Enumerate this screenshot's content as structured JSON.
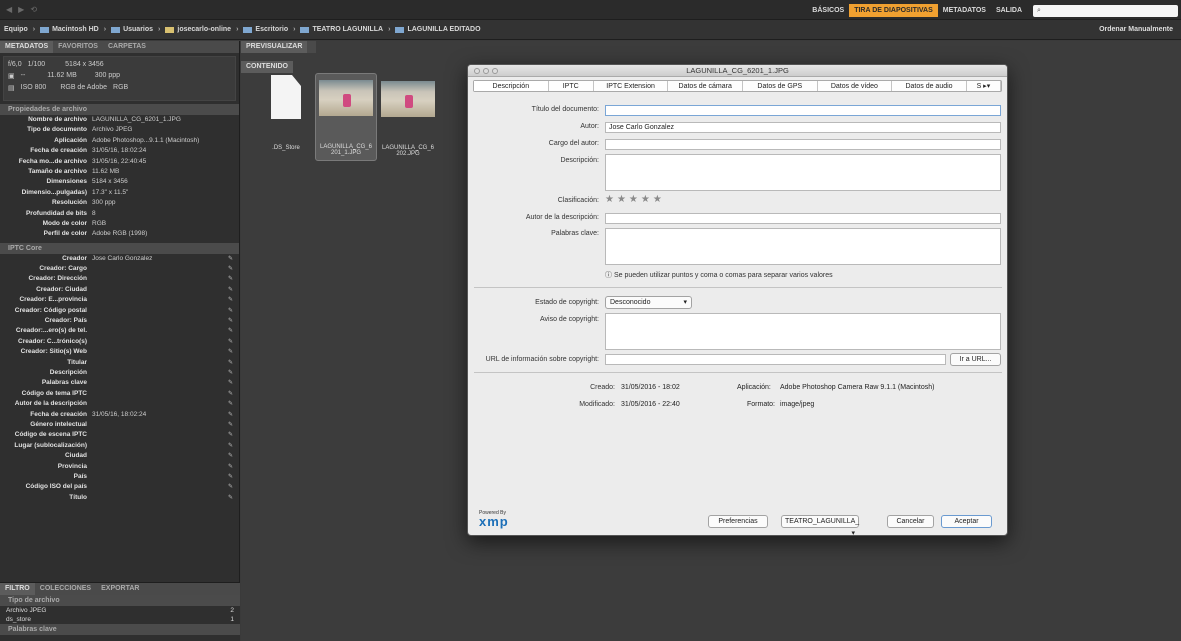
{
  "workspaces": [
    "BÁSICOS",
    "TIRA DE DIAPOSITIVAS",
    "METADATOS",
    "SALIDA"
  ],
  "active_workspace": "TIRA DE DIAPOSITIVAS",
  "path": [
    "Equipo",
    "Macintosh HD",
    "Usuarios",
    "josecarlo-online",
    "Escritorio",
    "TEATRO LAGUNILLA",
    "LAGUNILLA EDITADO"
  ],
  "sort_label": "Ordenar Manualmente",
  "left_tabs": [
    "METADATOS",
    "FAVORITOS",
    "CARPETAS"
  ],
  "camera": {
    "aperture": "f/6,0",
    "shutter": "1/100",
    "dims": "5184 x 3456",
    "size": "11.62 MB",
    "ppp": "300 ppp",
    "iso": "ISO 800",
    "profile": "RGB de Adobe",
    "mode": "RGB",
    "dash": "--"
  },
  "sections": {
    "file": "Propiedades de archivo",
    "iptc": "IPTC Core"
  },
  "file_props": [
    {
      "k": "Nombre de archivo",
      "v": "LAGUNILLA_CG_6201_1.JPG"
    },
    {
      "k": "Tipo de documento",
      "v": "Archivo JPEG"
    },
    {
      "k": "Aplicación",
      "v": "Adobe Photoshop...9.1.1 (Macintosh)"
    },
    {
      "k": "Fecha de creación",
      "v": "31/05/16, 18:02:24"
    },
    {
      "k": "Fecha mo...de archivo",
      "v": "31/05/16, 22:40:45"
    },
    {
      "k": "Tamaño de archivo",
      "v": "11.62 MB"
    },
    {
      "k": "Dimensiones",
      "v": "5184 x 3456"
    },
    {
      "k": "Dimensio...pulgadas)",
      "v": "17.3\" x 11.5\""
    },
    {
      "k": "Resolución",
      "v": "300 ppp"
    },
    {
      "k": "Profundidad de bits",
      "v": "8"
    },
    {
      "k": "Modo de color",
      "v": "RGB"
    },
    {
      "k": "Perfil de color",
      "v": "Adobe RGB (1998)"
    }
  ],
  "iptc_rows": [
    {
      "k": "Creador",
      "v": "Jose Carlo Gonzalez"
    },
    {
      "k": "Creador: Cargo",
      "v": ""
    },
    {
      "k": "Creador: Dirección",
      "v": ""
    },
    {
      "k": "Creador: Ciudad",
      "v": ""
    },
    {
      "k": "Creador: E...provincia",
      "v": ""
    },
    {
      "k": "Creador: Código postal",
      "v": ""
    },
    {
      "k": "Creador: País",
      "v": ""
    },
    {
      "k": "Creador:...ero(s) de tel.",
      "v": ""
    },
    {
      "k": "Creador: C...trónico(s)",
      "v": ""
    },
    {
      "k": "Creador: Sitio(s) Web",
      "v": ""
    },
    {
      "k": "Titular",
      "v": ""
    },
    {
      "k": "Descripción",
      "v": ""
    },
    {
      "k": "Palabras clave",
      "v": ""
    },
    {
      "k": "Código de tema IPTC",
      "v": ""
    },
    {
      "k": "Autor de la descripción",
      "v": ""
    },
    {
      "k": "Fecha de creación",
      "v": "31/05/16, 18:02:24"
    },
    {
      "k": "Género intelectual",
      "v": ""
    },
    {
      "k": "Código de escena IPTC",
      "v": ""
    },
    {
      "k": "Lugar (sublocalización)",
      "v": ""
    },
    {
      "k": "Ciudad",
      "v": ""
    },
    {
      "k": "Provincia",
      "v": ""
    },
    {
      "k": "País",
      "v": ""
    },
    {
      "k": "Código ISO del país",
      "v": ""
    },
    {
      "k": "Título",
      "v": ""
    }
  ],
  "filter_tabs": [
    "FILTRO",
    "COLECCIONES",
    "EXPORTAR"
  ],
  "filter": {
    "section1": "Tipo de archivo",
    "items": [
      {
        "label": "Archivo JPEG",
        "count": "2"
      },
      {
        "label": "ds_store",
        "count": "1"
      }
    ],
    "section2": "Palabras clave"
  },
  "content": {
    "tab_preview": "PREVISUALIZAR",
    "tab_content": "CONTENIDO",
    "files": [
      ".DS_Store",
      "LAGUNILLA_CG_6\n201_1.JPG",
      "LAGUNILLA_CG_6\n202.JPG"
    ]
  },
  "dialog": {
    "title": "LAGUNILLA_CG_6201_1.JPG",
    "tabs": [
      "Descripción",
      "IPTC",
      "IPTC Extension",
      "Datos de cámara",
      "Datos de GPS",
      "Datos de vídeo",
      "Datos de audio",
      "S"
    ],
    "labels": {
      "titulo": "Título del documento:",
      "autor": "Autor:",
      "cargo": "Cargo del autor:",
      "descripcion": "Descripción:",
      "clasificacion": "Clasificación:",
      "autor_desc": "Autor de la descripción:",
      "palabras": "Palabras clave:",
      "estado": "Estado de copyright:",
      "aviso": "Aviso de copyright:",
      "url": "URL de información sobre copyright:",
      "creado": "Creado:",
      "modificado": "Modificado:",
      "aplicacion": "Aplicación:",
      "formato": "Formato:"
    },
    "values": {
      "autor": "Jose Carlo Gonzalez",
      "estado": "Desconocido",
      "creado": "31/05/2016 - 18:02",
      "modificado": "31/05/2016 - 22:40",
      "aplicacion": "Adobe Photoshop Camera Raw 9.1.1 (Macintosh)",
      "formato": "image/jpeg"
    },
    "hint": "Se pueden utilizar puntos y coma o comas para separar varios valores",
    "btn_url": "Ir a URL...",
    "powered": "Powered By",
    "xmp": "xmp",
    "btn_pref": "Preferencias",
    "template": "TEATRO_LAGUNILLA_",
    "btn_cancel": "Cancelar",
    "btn_ok": "Aceptar"
  }
}
